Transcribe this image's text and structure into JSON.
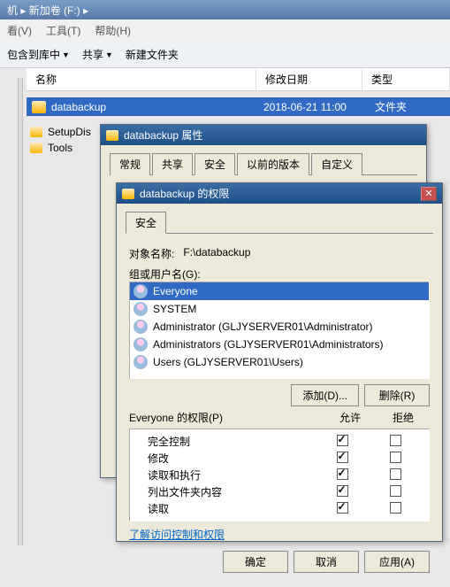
{
  "window": {
    "title_fragment": "机 ▸ 新加卷 (F:) ▸"
  },
  "menubar": {
    "view": "看(V)",
    "tools": "工具(T)",
    "help": "帮助(H)"
  },
  "toolbar": {
    "include": "包含到库中",
    "share": "共享",
    "newfolder": "新建文件夹"
  },
  "columns": {
    "name": "名称",
    "date": "修改日期",
    "type": "类型"
  },
  "files": {
    "selected": {
      "name": "databackup",
      "date": "2018-06-21 11:00",
      "type": "文件夹"
    },
    "tree": [
      {
        "name": "SetupDis"
      },
      {
        "name": "Tools"
      }
    ]
  },
  "dlg1": {
    "title": "databackup 属性",
    "tabs": [
      "常规",
      "共享",
      "安全",
      "以前的版本",
      "自定义"
    ]
  },
  "dlg2": {
    "title": "databackup 的权限",
    "tab": "安全",
    "obj_label": "对象名称:",
    "obj_value": "F:\\databackup",
    "group_label": "组或用户名(G):",
    "users": [
      "Everyone",
      "SYSTEM",
      "Administrator (GLJYSERVER01\\Administrator)",
      "Administrators (GLJYSERVER01\\Administrators)",
      "Users (GLJYSERVER01\\Users)"
    ],
    "add_btn": "添加(D)...",
    "remove_btn": "删除(R)",
    "perm_header": "Everyone 的权限(P)",
    "allow": "允许",
    "deny": "拒绝",
    "perms": [
      {
        "name": "完全控制",
        "allow": true,
        "deny": false
      },
      {
        "name": "修改",
        "allow": true,
        "deny": false
      },
      {
        "name": "读取和执行",
        "allow": true,
        "deny": false
      },
      {
        "name": "列出文件夹内容",
        "allow": true,
        "deny": false
      },
      {
        "name": "读取",
        "allow": true,
        "deny": false
      }
    ],
    "link": "了解访问控制和权限",
    "ok": "确定",
    "cancel": "取消",
    "apply": "应用(A)"
  }
}
